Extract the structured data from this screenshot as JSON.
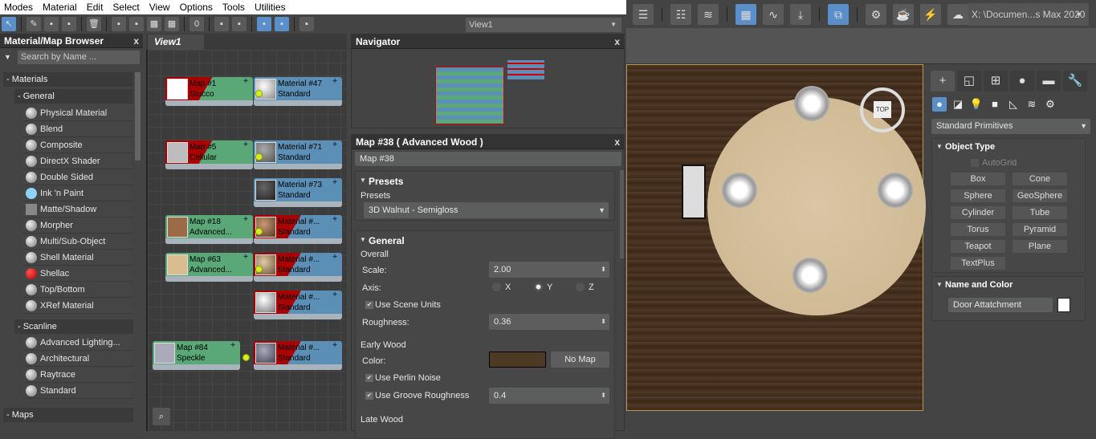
{
  "menu": [
    "Modes",
    "Material",
    "Edit",
    "Select",
    "View",
    "Options",
    "Tools",
    "Utilities"
  ],
  "left_toolbar": {
    "icons": [
      "select-arrow",
      "eyedropper",
      "put-material",
      "assign-material",
      "delete",
      "move-children",
      "layout-children",
      "background",
      "checker",
      "zero-slot",
      "layout-all",
      "tree-layout",
      "show-shaded",
      "show-map",
      "pick-material"
    ],
    "view_select": "View1"
  },
  "browser": {
    "title": "Material/Map Browser",
    "close": "x",
    "search_placeholder": "Search by Name ...",
    "materials_header": "- Materials",
    "general_header": "- General",
    "general_items": [
      "Physical Material",
      "Blend",
      "Composite",
      "DirectX Shader",
      "Double Sided",
      "Ink 'n Paint",
      "Matte/Shadow",
      "Morpher",
      "Multi/Sub-Object",
      "Shell Material",
      "Shellac",
      "Top/Bottom",
      "XRef Material"
    ],
    "scanline_header": "- Scanline",
    "scanline_items": [
      "Advanced Lighting...",
      "Architectural",
      "Raytrace",
      "Standard"
    ],
    "maps_header": "- Maps"
  },
  "view": {
    "tab": "View1",
    "binoculars": "binoculars-icon"
  },
  "nodes": {
    "maps": [
      {
        "name": "Map #1",
        "type": "Stucco",
        "row": 0
      },
      {
        "name": "Map #5",
        "type": "Cellular",
        "row": 1
      },
      {
        "name": "Map #18",
        "type": "Advanced...",
        "row": 3
      },
      {
        "name": "Map #63",
        "type": "Advanced...",
        "row": 4
      },
      {
        "name": "Map #84",
        "type": "Speckle",
        "row": 6
      }
    ],
    "materials": [
      {
        "name": "Material #47",
        "type": "Standard"
      },
      {
        "name": "Material #71",
        "type": "Standard"
      },
      {
        "name": "Material #73",
        "type": "Standard"
      },
      {
        "name": "Material #...",
        "type": "Standard"
      },
      {
        "name": "Material #...",
        "type": "Standard"
      },
      {
        "name": "Material #...",
        "type": "Standard"
      },
      {
        "name": "Material #...",
        "type": "Standard"
      }
    ]
  },
  "navigator": {
    "title": "Navigator",
    "close": "x"
  },
  "params": {
    "title": "Map #38  ( Advanced Wood )",
    "close": "x",
    "name_field": "Map #38",
    "presets": {
      "rollout": "Presets",
      "group": "Presets",
      "value": "3D Walnut - Semigloss"
    },
    "general": {
      "rollout": "General",
      "overall": "Overall",
      "scale_label": "Scale:",
      "scale": "2.00",
      "axis_label": "Axis:",
      "axes": [
        "X",
        "Y",
        "Z"
      ],
      "axis_selected": "Y",
      "use_scene_units": "Use Scene Units",
      "roughness_label": "Roughness:",
      "roughness": "0.36",
      "early_wood": "Early Wood",
      "color_label": "Color:",
      "color": "#4e3a22",
      "no_map": "No Map",
      "use_perlin": "Use Perlin Noise",
      "use_groove": "Use Groove Roughness",
      "groove": "0.4",
      "late_wood": "Late Wood"
    }
  },
  "right_toolbar": {
    "icons": [
      "layer-explorer",
      "scene-list",
      "layers",
      "slate-editor",
      "curve-editor",
      "schematic",
      "material-editor",
      "render-setup",
      "rendered-frame",
      "render",
      "render-cloud",
      "viewports"
    ],
    "path": "X: \\Documen...s Max 2020"
  },
  "command_panel": {
    "tabs": [
      "create",
      "modify",
      "hierarchy",
      "motion",
      "display",
      "utilities"
    ],
    "categories": [
      "geometry",
      "shapes",
      "lights",
      "cameras",
      "helpers",
      "spacewarps",
      "systems"
    ],
    "dropdown": "Standard Primitives",
    "object_type": "Object Type",
    "autogrid": "AutoGrid",
    "buttons": [
      "Box",
      "Cone",
      "Sphere",
      "GeoSphere",
      "Cylinder",
      "Tube",
      "Torus",
      "Pyramid",
      "Teapot",
      "Plane",
      "TextPlus"
    ],
    "name_and_color": "Name and Color",
    "object_name": "Door Attatchment",
    "object_color": "#ffffff"
  },
  "viewcube": "TOP"
}
